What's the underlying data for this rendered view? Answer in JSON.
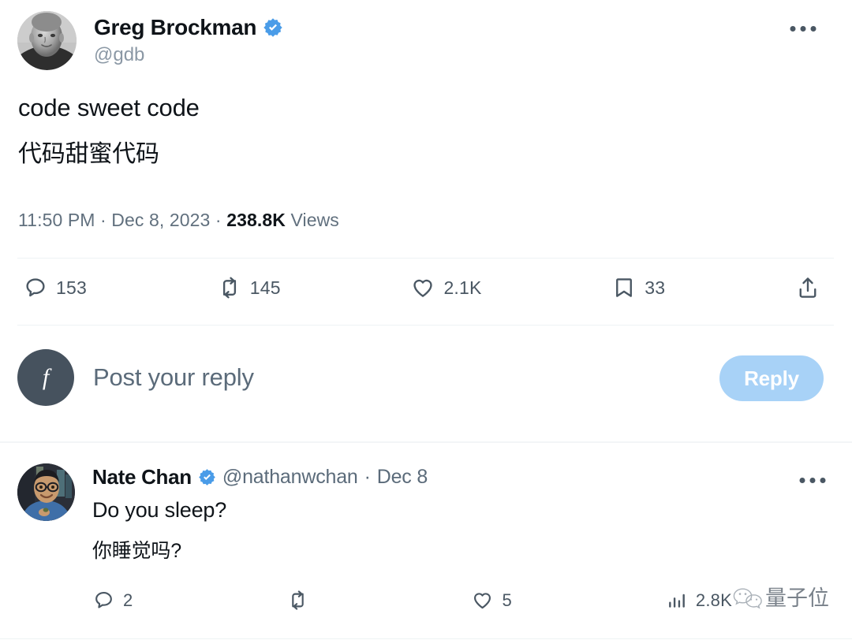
{
  "main_tweet": {
    "author": {
      "display_name": "Greg Brockman",
      "handle": "@gdb",
      "verified": true,
      "avatar_alt": "grayscale-portrait-photo"
    },
    "text_en": "code sweet code",
    "text_zh": "代码甜蜜代码",
    "timestamp": "11:50 PM",
    "separator_1": " · ",
    "date": "Dec 8, 2023",
    "separator_2": " · ",
    "views_count": "238.8K",
    "views_label": "Views",
    "actions": {
      "reply": {
        "icon": "reply-icon",
        "count": "153"
      },
      "retweet": {
        "icon": "retweet-icon",
        "count": "145"
      },
      "like": {
        "icon": "heart-icon",
        "count": "2.1K"
      },
      "bookmark": {
        "icon": "bookmark-icon",
        "count": "33"
      },
      "share": {
        "icon": "share-icon",
        "count": ""
      }
    },
    "more_menu": "more-options"
  },
  "composer": {
    "avatar_letter": "f",
    "placeholder": "Post your reply",
    "button_label": "Reply"
  },
  "reply_post": {
    "author": {
      "display_name": "Nate Chan",
      "handle": "@nathanwchan",
      "verified": true,
      "avatar_alt": "person-with-glasses-photo"
    },
    "separator": " · ",
    "date": "Dec 8",
    "text_en": "Do you sleep?",
    "text_zh": "你睡觉吗?",
    "actions": {
      "reply": {
        "icon": "reply-icon",
        "count": "2"
      },
      "retweet": {
        "icon": "retweet-icon",
        "count": ""
      },
      "like": {
        "icon": "heart-icon",
        "count": "5"
      },
      "views": {
        "icon": "analytics-icon",
        "count": "2.8K"
      }
    },
    "more_menu": "more-options"
  },
  "watermark": {
    "icon": "wechat-icon",
    "text": "量子位"
  },
  "colors": {
    "verified_blue": "#4a9ce8",
    "reply_button_bg": "#a8d2f7",
    "text_primary": "#0f1419",
    "text_secondary": "#61707e",
    "icon_color": "#4a5763",
    "divider": "#eef3f4",
    "composer_avatar_bg": "#46525e"
  }
}
